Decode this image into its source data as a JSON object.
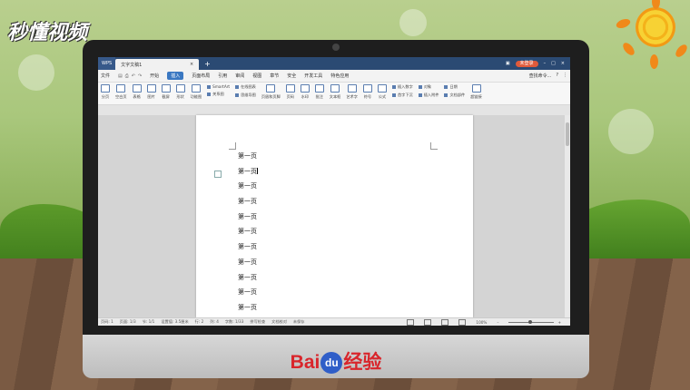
{
  "watermark": {
    "brand": "秒懂视频"
  },
  "window": {
    "app_tab": "WPS",
    "doc_tab": "文字文稿1",
    "close_symbol": "×",
    "new_tab_symbol": "+",
    "login_label": "未登录"
  },
  "menu": {
    "file_label": "文件",
    "items": [
      "开始",
      "插入",
      "页面布局",
      "引用",
      "审阅",
      "视图",
      "章节",
      "安全",
      "开发工具",
      "特色应用"
    ],
    "active_index": 1,
    "search_label": "查找命令...",
    "help": "?",
    "more": "⋮"
  },
  "ribbon": {
    "buttons": [
      "分页",
      "空白页",
      "表格",
      "图片",
      "截屏",
      "形状",
      "功能图",
      "图标",
      "流程图",
      "页眉和页脚",
      "页码",
      "水印",
      "批注",
      "文本框",
      "艺术字",
      "符号",
      "公式",
      "日期",
      "超链接"
    ],
    "small_items": [
      "SmartArt",
      "关系图",
      "在线图表",
      "思维导图",
      "插入数字",
      "对象",
      "首字下沉",
      "插入附件",
      "文档部件"
    ]
  },
  "document": {
    "lines": [
      "第一页",
      "第一页",
      "第一页",
      "第一页",
      "第一页",
      "第一页",
      "第一页",
      "第一页",
      "第一页",
      "第一页",
      "第一页"
    ],
    "cursor_line_index": 1
  },
  "status": {
    "page_num": "页码: 1",
    "pages": "页面: 1/3",
    "section": "节: 1/1",
    "setting": "设置值: 3.5厘米",
    "row": "行: 2",
    "col": "列: 4",
    "wordcount": "字数: 1/33",
    "spellcheck": "拼写检查",
    "compare": "文档校对",
    "unsaved": "未保存",
    "zoom": "100%"
  },
  "footer": {
    "brand_left": "Bai",
    "brand_du": "du",
    "brand_right": "经验"
  },
  "colors": {
    "titlebar": "#2b4a73",
    "accent": "#3b78c2",
    "baidu_red": "#d9252b",
    "baidu_blue": "#2f5ec8"
  }
}
